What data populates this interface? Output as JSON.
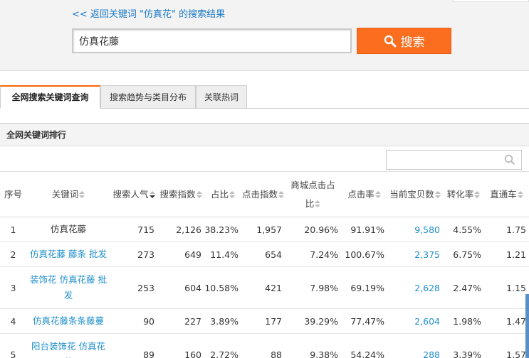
{
  "header": {
    "back_link": "<< 返回关键词 \"仿真花\" 的搜索结果",
    "search_value": "仿真花藤",
    "search_button": "搜索"
  },
  "tabs": [
    {
      "label": "全网搜索关键词查询",
      "active": true
    },
    {
      "label": "搜索趋势与类目分布",
      "active": false
    },
    {
      "label": "关联热词",
      "active": false
    }
  ],
  "panel": {
    "title": "全网关键词排行",
    "filter_placeholder": ""
  },
  "table": {
    "headers": {
      "rank": "序号",
      "keyword": "关键词",
      "popularity": "搜索人气",
      "index": "搜索指数",
      "share": "占比",
      "clicks": "点击指数",
      "mall_line1": "商城点击占",
      "mall_line2": "比",
      "ctr": "点击率",
      "items": "当前宝贝数",
      "conversion": "转化率",
      "ztc": "直通车"
    },
    "rows": [
      {
        "rank": "1",
        "keyword": "仿真花藤",
        "popularity": "715",
        "index": "2,126",
        "share": "38.23%",
        "clicks": "1,957",
        "mall": "20.96%",
        "ctr": "91.91%",
        "items": "9,580",
        "conversion": "4.55%",
        "ztc": "1.75"
      },
      {
        "rank": "2",
        "keyword": "仿真花藤 藤条 批发",
        "popularity": "273",
        "index": "649",
        "share": "11.4%",
        "clicks": "654",
        "mall": "7.24%",
        "ctr": "100.67%",
        "items": "2,375",
        "conversion": "6.75%",
        "ztc": "1.21"
      },
      {
        "rank": "3",
        "keyword": "装饰花 仿真花藤 批发",
        "popularity": "253",
        "index": "604",
        "share": "10.58%",
        "clicks": "421",
        "mall": "7.98%",
        "ctr": "69.19%",
        "items": "2,628",
        "conversion": "2.47%",
        "ztc": "1.15"
      },
      {
        "rank": "4",
        "keyword": "仿真花藤条条藤蔓",
        "popularity": "90",
        "index": "227",
        "share": "3.89%",
        "clicks": "177",
        "mall": "39.29%",
        "ctr": "77.47%",
        "items": "2,604",
        "conversion": "1.98%",
        "ztc": "1.47"
      },
      {
        "rank": "5",
        "keyword": "阳台装饰花 仿真花藤",
        "popularity": "89",
        "index": "160",
        "share": "2.72%",
        "clicks": "88",
        "mall": "9.38%",
        "ctr": "54.24%",
        "items": "288",
        "conversion": "3.39%",
        "ztc": "1.57"
      }
    ]
  },
  "colors": {
    "accent": "#fb6d1f",
    "link": "#1f8fc9",
    "tab_active": "#ff6600"
  }
}
